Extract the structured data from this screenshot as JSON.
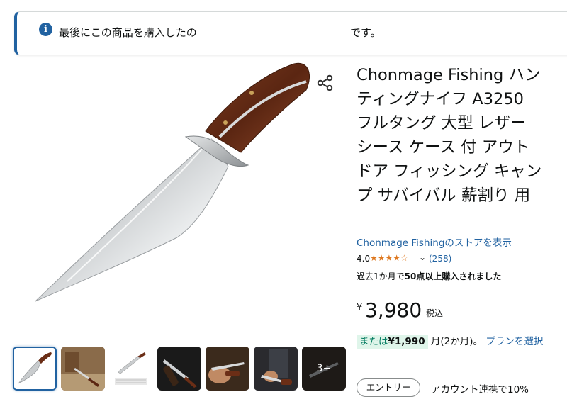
{
  "notice": {
    "text_start": "最後にこの商品を購入したの",
    "text_end": "です。"
  },
  "product": {
    "title": "Chonmage Fishing ハンティングナイフ A3250 フルタング 大型 レザー シース ケース 付 アウトドア フィッシング キャンプ サバイバル 薪割り 用",
    "store_link": "Chonmage Fishingのストアを表示",
    "rating": "4.0",
    "rating_value": 4.0,
    "stars": "★★★★☆",
    "review_count": "(258)",
    "bought_prefix": "過去1か月で",
    "bought_bold": "50点以上購入されました",
    "price_symbol": "¥",
    "price": "3,980",
    "tax": "税込",
    "installment_prefix": "または",
    "installment_amount": "¥1,990",
    "installment_suffix": "月(2か月)。",
    "installment_link": "プランを選択",
    "entry_badge": "エントリー",
    "points_text": "アカウント連携で10%"
  },
  "thumbnails": {
    "more_label": "3+"
  },
  "colors": {
    "accent": "#2162a1",
    "star": "#de7921",
    "installment_bg": "#dff5ea",
    "installment_text": "#067d62"
  },
  "icons": {
    "info": "info-icon",
    "share": "share-icon",
    "chevron": "chevron-down-icon"
  }
}
